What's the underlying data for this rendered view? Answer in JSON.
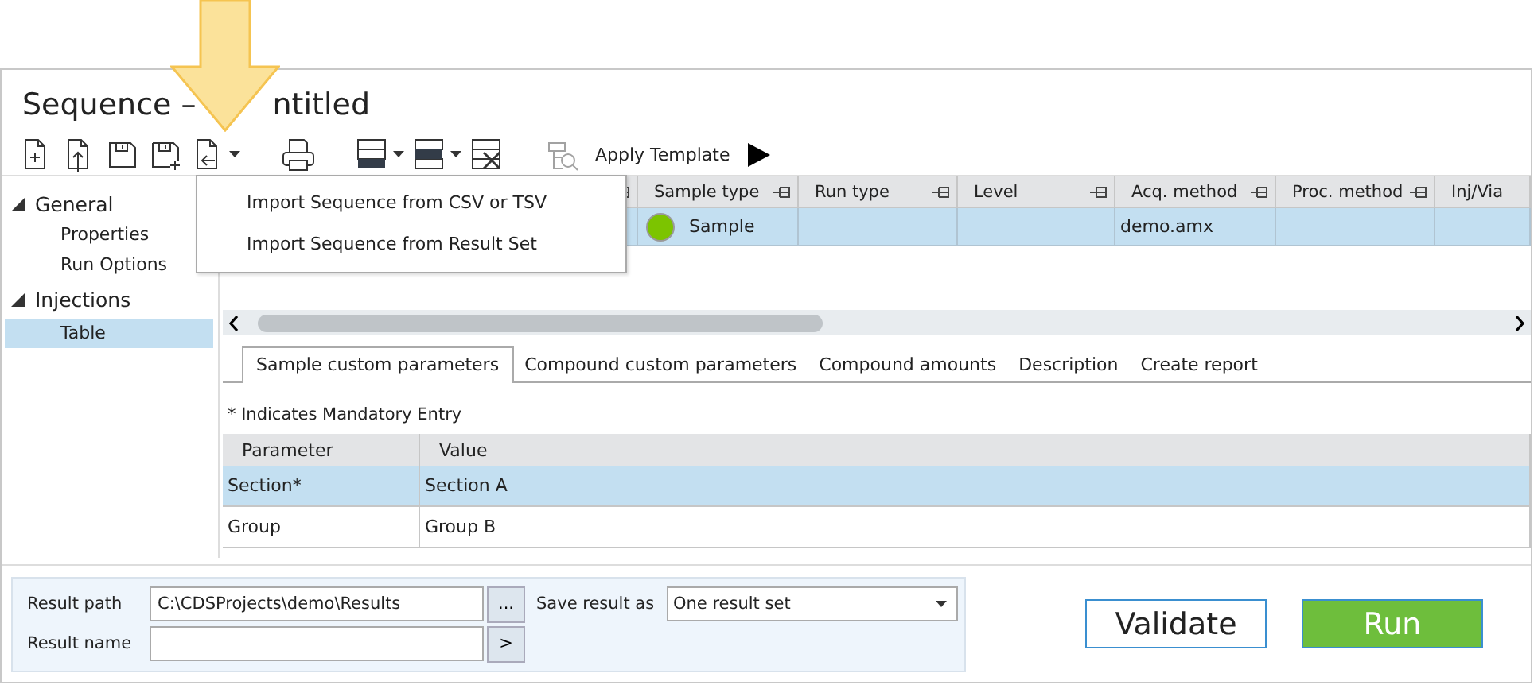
{
  "title_parts": [
    "Sequence –",
    "ntitled"
  ],
  "toolbar": [
    {
      "kind": "new",
      "dropdown": false
    },
    {
      "kind": "open",
      "dropdown": false
    },
    {
      "kind": "save",
      "dropdown": false
    },
    {
      "kind": "save-as",
      "dropdown": false
    },
    {
      "kind": "import",
      "dropdown": true
    },
    {
      "kind": "print",
      "dropdown": false
    },
    {
      "kind": "insert-below",
      "dropdown": true
    },
    {
      "kind": "insert-middle",
      "dropdown": true
    },
    {
      "kind": "delete",
      "dropdown": false
    },
    {
      "kind": "template",
      "dropdown": false,
      "disabled": true
    }
  ],
  "apply_template": "Apply Template",
  "menu": {
    "items": [
      "Import Sequence from CSV or TSV",
      "Import Sequence from Result Set"
    ]
  },
  "sidebar": [
    {
      "label": "General",
      "expanded": true,
      "selected": false,
      "children": [
        {
          "label": "Properties",
          "selected": false
        },
        {
          "label": "Run Options",
          "selected": false
        }
      ]
    },
    {
      "label": "Injections",
      "expanded": true,
      "selected": false,
      "children": [
        {
          "label": "Table",
          "selected": true
        }
      ]
    }
  ],
  "grid": {
    "columns": [
      {
        "pin": true
      },
      {
        "label": "Sample type",
        "pin": true
      },
      {
        "label": "Run type",
        "pin": true
      },
      {
        "label": "Level",
        "pin": true
      },
      {
        "label": "Acq. method",
        "pin": true
      },
      {
        "label": "Proc. method",
        "pin": true
      },
      {
        "label": "Inj/Via",
        "pin": false
      }
    ],
    "rows": [
      {
        "selected": true,
        "cells": [
          {},
          {
            "text": "Sample",
            "color": "#7cc400"
          },
          {},
          {},
          {
            "text": "demo.amx"
          },
          {},
          {}
        ]
      }
    ]
  },
  "tabs": [
    {
      "label": "Sample custom parameters",
      "selected": true
    },
    {
      "label": "Compound custom parameters",
      "selected": false
    },
    {
      "label": "Compound amounts",
      "selected": false
    },
    {
      "label": "Description",
      "selected": false
    },
    {
      "label": "Create report",
      "selected": false
    }
  ],
  "note": "* Indicates Mandatory Entry",
  "params": {
    "columns": [
      "Parameter",
      "Value"
    ],
    "rows": [
      {
        "selected": true,
        "cells": [
          "Section*",
          "Section A"
        ]
      },
      {
        "selected": false,
        "cells": [
          "Group",
          "Group B"
        ]
      }
    ]
  },
  "result": {
    "path_label": "Result path",
    "path_value": "C:\\CDSProjects\\demo\\Results",
    "browse": "...",
    "name_label": "Result name",
    "go": ">",
    "save_label": "Save result as",
    "save_value": "One result set"
  },
  "buttons": [
    {
      "label": "Validate",
      "kind": "secondary"
    },
    {
      "label": "Run",
      "kind": "primary"
    }
  ]
}
